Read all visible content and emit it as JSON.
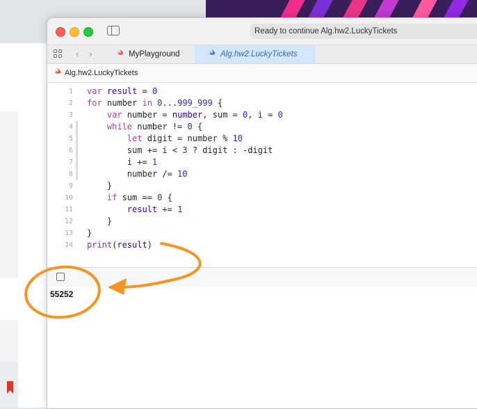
{
  "window": {
    "status_text": "Ready to continue Alg.hw2.LuckyTickets"
  },
  "tabs": [
    {
      "label": "MyPlayground",
      "active": false
    },
    {
      "label": "Alg.hw2.LuckyTickets",
      "active": true
    }
  ],
  "breadcrumb": {
    "label": "Alg.hw2.LuckyTickets"
  },
  "editor": {
    "line_numbers": [
      "1",
      "2",
      "3",
      "4",
      "5",
      "6",
      "7",
      "8",
      "9",
      "10",
      "11",
      "12",
      "13",
      "14"
    ],
    "lines": [
      [
        {
          "t": "var ",
          "c": "kw"
        },
        {
          "t": "result",
          "c": "var"
        },
        {
          "t": " = ",
          "c": "plain"
        },
        {
          "t": "0",
          "c": "num"
        }
      ],
      [
        {
          "t": "for ",
          "c": "kw"
        },
        {
          "t": "number ",
          "c": "plain"
        },
        {
          "t": "in ",
          "c": "kw"
        },
        {
          "t": "0",
          "c": "num"
        },
        {
          "t": "...",
          "c": "plain"
        },
        {
          "t": "999_999",
          "c": "num"
        },
        {
          "t": " {",
          "c": "plain"
        }
      ],
      [
        {
          "t": "    var ",
          "c": "kw"
        },
        {
          "t": "number",
          "c": "plain"
        },
        {
          "t": " = ",
          "c": "plain"
        },
        {
          "t": "number",
          "c": "var"
        },
        {
          "t": ", sum = ",
          "c": "plain"
        },
        {
          "t": "0",
          "c": "num"
        },
        {
          "t": ", i = ",
          "c": "plain"
        },
        {
          "t": "0",
          "c": "num"
        }
      ],
      [
        {
          "t": "    while ",
          "c": "kw"
        },
        {
          "t": "number != ",
          "c": "plain"
        },
        {
          "t": "0",
          "c": "num"
        },
        {
          "t": " {",
          "c": "plain"
        }
      ],
      [
        {
          "t": "        let ",
          "c": "kw"
        },
        {
          "t": "digit = number % ",
          "c": "plain"
        },
        {
          "t": "10",
          "c": "num"
        }
      ],
      [
        {
          "t": "        sum += i < ",
          "c": "plain"
        },
        {
          "t": "3",
          "c": "num"
        },
        {
          "t": " ? digit : -digit",
          "c": "plain"
        }
      ],
      [
        {
          "t": "        i += ",
          "c": "plain"
        },
        {
          "t": "1",
          "c": "num"
        }
      ],
      [
        {
          "t": "        number /= ",
          "c": "plain"
        },
        {
          "t": "10",
          "c": "num"
        }
      ],
      [
        {
          "t": "    }",
          "c": "plain"
        }
      ],
      [
        {
          "t": "    if ",
          "c": "kw"
        },
        {
          "t": "sum == ",
          "c": "plain"
        },
        {
          "t": "0",
          "c": "num"
        },
        {
          "t": " {",
          "c": "plain"
        }
      ],
      [
        {
          "t": "        result",
          "c": "var"
        },
        {
          "t": " += ",
          "c": "plain"
        },
        {
          "t": "1",
          "c": "num"
        }
      ],
      [
        {
          "t": "    }",
          "c": "plain"
        }
      ],
      [
        {
          "t": "}",
          "c": "plain"
        }
      ],
      [
        {
          "t": "print",
          "c": "fn"
        },
        {
          "t": "(",
          "c": "plain"
        },
        {
          "t": "result",
          "c": "var"
        },
        {
          "t": ")",
          "c": "plain"
        }
      ]
    ]
  },
  "console": {
    "output": "55252"
  },
  "colors": {
    "keyword": "#ad3da4",
    "number": "#272ad8",
    "variable": "#3900a0",
    "annotation": "#f49422",
    "active_tab_bg": "#d4e6f9"
  },
  "icons": {
    "sidebar_toggle": "sidebar-toggle-icon",
    "grid": "grid-icon",
    "back": "chevron-left-icon",
    "forward": "chevron-right-icon",
    "swift": "swift-icon",
    "run": "play-circle-icon",
    "debug_toggle": "debug-area-toggle-icon"
  }
}
